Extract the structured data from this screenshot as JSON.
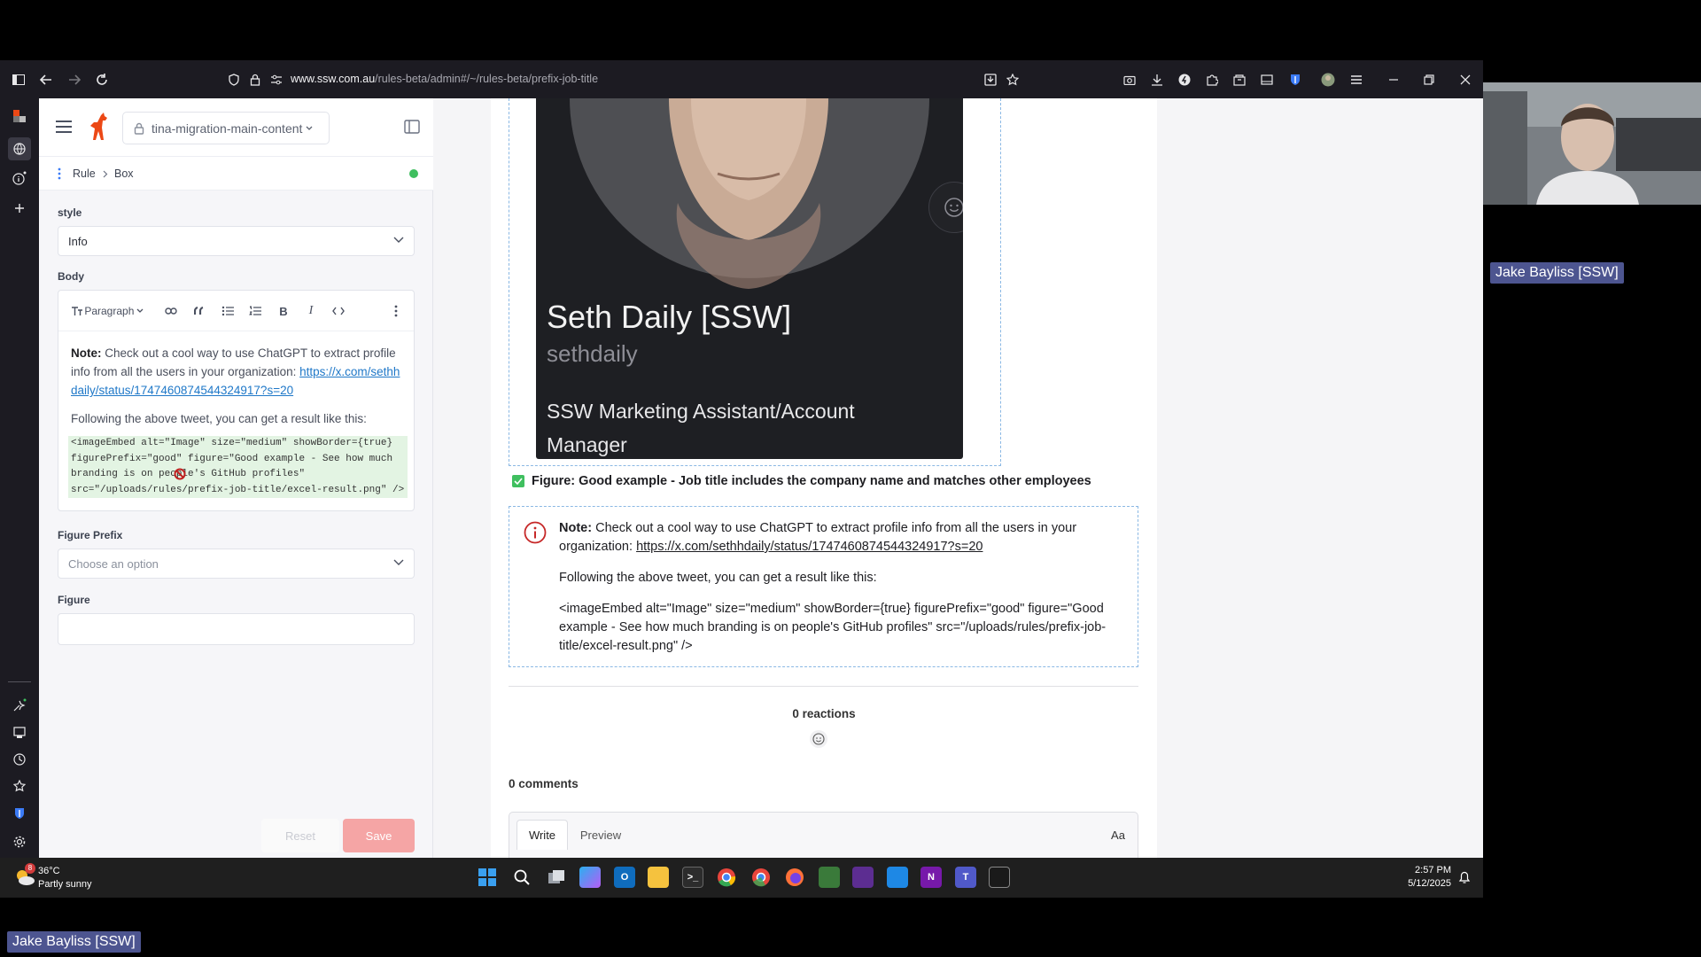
{
  "browser": {
    "url_domain": "www.ssw.com.au",
    "url_path": "/rules-beta/admin#/~/rules-beta/prefix-job-title"
  },
  "tina": {
    "branch": "tina-migration-main-content",
    "breadcrumb": [
      "Rule",
      "Box"
    ],
    "style_label": "style",
    "style_value": "Info",
    "body_label": "Body",
    "toolbar_paragraph": "Paragraph",
    "note_bold": "Note:",
    "note_text": " Check out a cool way to use ChatGPT to extract profile info from all the users in your organization: ",
    "note_link": "https://x.com/sethhdaily/status/1747460874544324917?s=20",
    "following": "Following the above tweet, you can get a result like this:",
    "code": "<imageEmbed alt=\"Image\" size=\"medium\" showBorder={true} figurePrefix=\"good\" figure=\"Good example - See how much branding is on people's GitHub profiles\" src=\"/uploads/rules/prefix-job-title/excel-result.png\" />",
    "figure_prefix_label": "Figure Prefix",
    "figure_prefix_placeholder": "Choose an option",
    "figure_label": "Figure",
    "reset": "Reset",
    "save": "Save"
  },
  "preview": {
    "profile_name": "Seth Daily [SSW]",
    "profile_handle": "sethdaily",
    "profile_title": "SSW Marketing Assistant/Account Manager",
    "figure_caption": "Figure: Good example - Job title includes the company name and matches other employees",
    "note_bold": "Note:",
    "note_text": " Check out a cool way to use ChatGPT to extract profile info from all the users in your organization: ",
    "note_link": "https://x.com/sethhdaily/status/1747460874544324917?s=20",
    "following": "Following the above tweet, you can get a result like this:",
    "code": "<imageEmbed alt=\"Image\" size=\"medium\" showBorder={true} figurePrefix=\"good\" figure=\"Good example - See how much branding is on people's GitHub profiles\" src=\"/uploads/rules/prefix-job-title/excel-result.png\" />",
    "reactions": "0 reactions",
    "comments": "0 comments",
    "tab_write": "Write",
    "tab_preview": "Preview",
    "aa": "Aa"
  },
  "overlay": {
    "webcam_name": "Jake Bayliss [SSW]",
    "bottom_name": "Jake Bayliss [SSW]"
  },
  "taskbar": {
    "weather_temp": "36°C",
    "weather_desc": "Partly sunny",
    "weather_badge": "8",
    "time": "2:57 PM",
    "date": "5/12/2025"
  },
  "colors": {
    "accent_red": "#ec4815",
    "save_disabled": "#f5a5a5",
    "link_blue": "#1f78c8",
    "status_green": "#3fbf5f"
  }
}
